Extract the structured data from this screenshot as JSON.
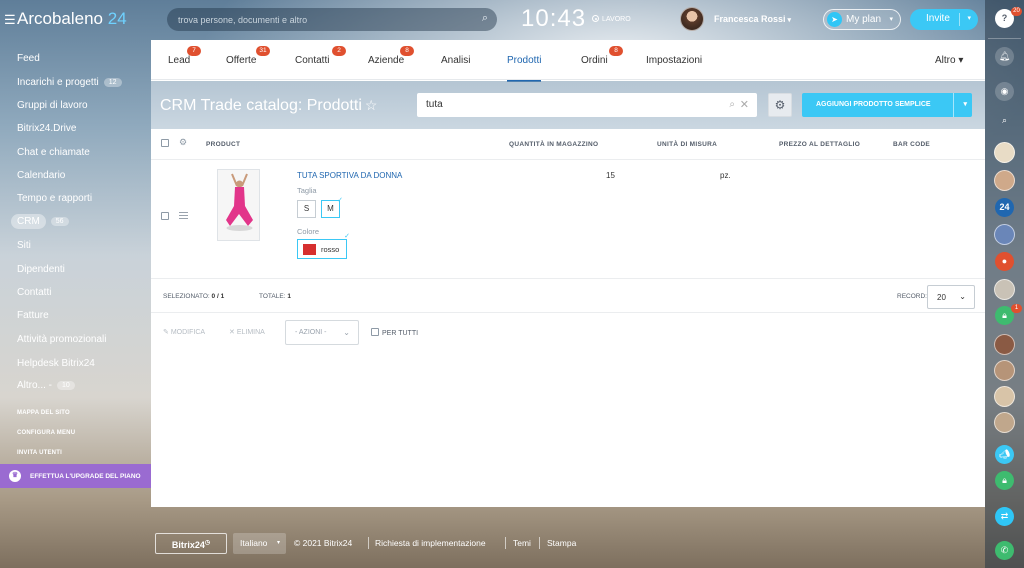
{
  "topbar": {
    "logo_text": "Arcobaleno",
    "logo_num": "24",
    "search_placeholder": "trova persone, documenti e altro",
    "clock": "10:43",
    "work_status": "LAVORO",
    "user_name": "Francesca Rossi",
    "myplan_label": "My plan",
    "invite_label": "Invite"
  },
  "left_menu": {
    "items": [
      {
        "label": "Feed",
        "counter": ""
      },
      {
        "label": "Incarichi e progetti",
        "counter": "12"
      },
      {
        "label": "Gruppi di lavoro",
        "counter": ""
      },
      {
        "label": "Bitrix24.Drive",
        "counter": ""
      },
      {
        "label": "Chat e chiamate",
        "counter": ""
      },
      {
        "label": "Calendario",
        "counter": ""
      },
      {
        "label": "Tempo e rapporti",
        "counter": ""
      },
      {
        "label": "CRM",
        "counter": "56",
        "active": true
      },
      {
        "label": "Siti",
        "counter": ""
      },
      {
        "label": "Dipendenti",
        "counter": ""
      },
      {
        "label": "Contatti",
        "counter": ""
      },
      {
        "label": "Fatture",
        "counter": ""
      },
      {
        "label": "Attività promozionali",
        "counter": ""
      },
      {
        "label": "Helpdesk Bitrix24",
        "counter": ""
      },
      {
        "label": "Altro... -",
        "counter": "10"
      }
    ],
    "links": [
      "MAPPA DEL SITO",
      "CONFIGURA MENU",
      "INVITA UTENTI"
    ],
    "upgrade_label": "EFFETTUA L'UPGRADE DEL PIANO"
  },
  "tabs": [
    {
      "label": "Lead",
      "badge": "7"
    },
    {
      "label": "Offerte",
      "badge": "31"
    },
    {
      "label": "Contatti",
      "badge": "2"
    },
    {
      "label": "Aziende",
      "badge": "8"
    },
    {
      "label": "Analisi",
      "badge": ""
    },
    {
      "label": "Prodotti",
      "badge": "",
      "active": true
    },
    {
      "label": "Ordini",
      "badge": "8"
    },
    {
      "label": "Impostazioni",
      "badge": ""
    }
  ],
  "tabs_more": "Altro",
  "header": {
    "title": "CRM Trade catalog: Prodotti",
    "filter_value": "tuta",
    "add_button": "AGGIUNGI PRODOTTO SEMPLICE"
  },
  "grid": {
    "columns": [
      "PRODUCT",
      "QUANTITÀ IN MAGAZZINO",
      "UNITÀ DI MISURA",
      "PREZZO AL DETTAGLIO",
      "BAR CODE"
    ],
    "rows": [
      {
        "name": "TUTA SPORTIVA DA DONNA",
        "quantity": "15",
        "unit": "pz.",
        "size_label": "Taglia",
        "sizes": [
          "S",
          "M"
        ],
        "selected_size": "M",
        "color_label": "Colore",
        "color_name": "rosso",
        "color_hex": "#d62f2f"
      }
    ],
    "footer": {
      "selected_label": "SELEZIONATO:",
      "selected_value": "0 / 1",
      "total_label": "TOTALE:",
      "total_value": "1",
      "records_label": "RECORD:",
      "records_value": "20"
    },
    "actions": {
      "edit": "MODIFICA",
      "delete": "ELIMINA",
      "actions_select": "- AZIONI -",
      "for_all": "PER TUTTI"
    }
  },
  "footer": {
    "brand": "Bitrix24",
    "language": "Italiano",
    "copyright": "© 2021 Bitrix24",
    "links": [
      "Richiesta di implementazione",
      "Temi",
      "Stampa"
    ]
  },
  "right_bar": {
    "help_badge": "20",
    "lock_badge": "1"
  },
  "colors": {
    "accent": "#3bc8f5",
    "link": "#2067b0",
    "badge": "#e0502f",
    "upgrade": "#9a6bd1"
  }
}
